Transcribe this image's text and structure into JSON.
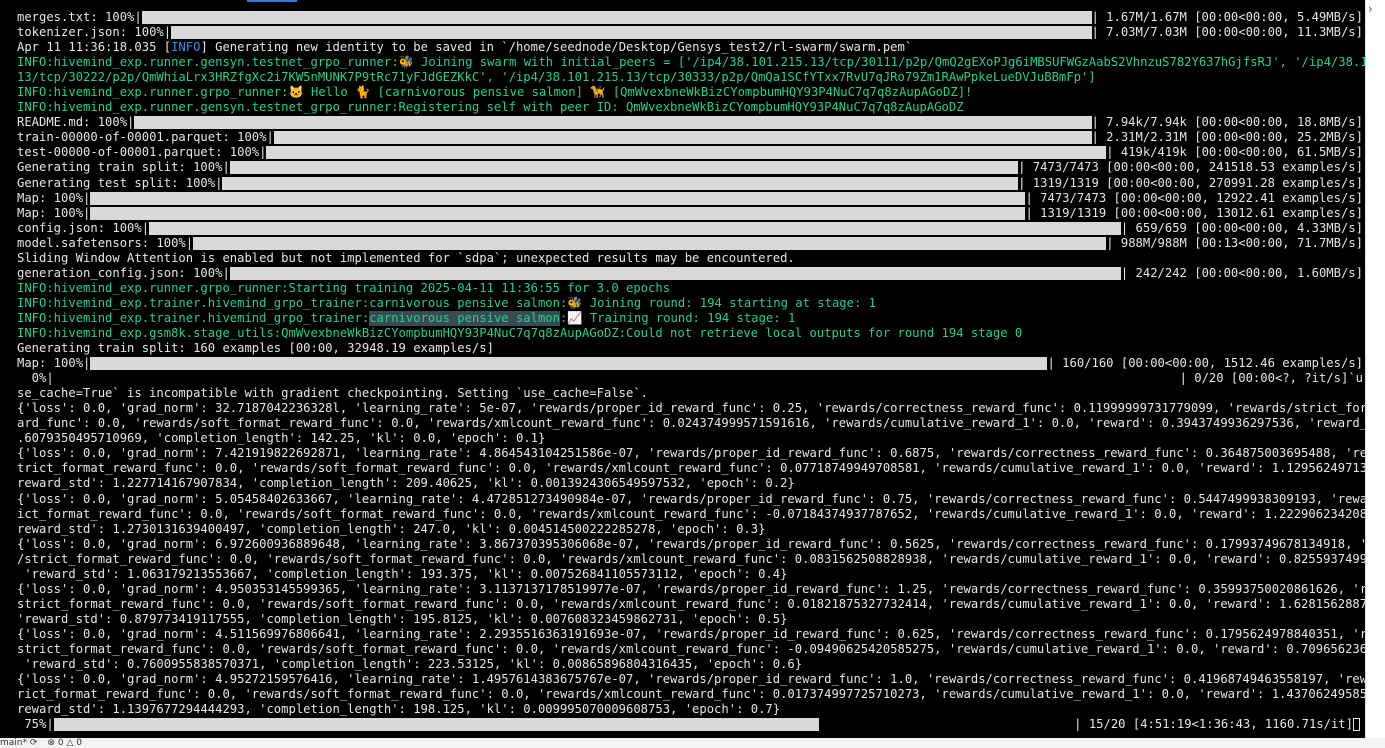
{
  "status_bar": {
    "branch": "main*",
    "sync_icon": "sync-icon",
    "problems": "0",
    "warnings": "0"
  },
  "lines": [
    {
      "type": "bar",
      "label": "merges.txt: 100%",
      "fill": 1.0,
      "stats": "| 1.67M/1.67M [00:00<00:00, 5.49MB/s]"
    },
    {
      "type": "bar",
      "label": "tokenizer.json: 100%",
      "fill": 1.0,
      "stats": "| 7.03M/7.03M [00:00<00:00, 11.3MB/s]"
    },
    {
      "type": "text",
      "segments": [
        {
          "t": "Apr 11 11:36:18.035 ["
        },
        {
          "t": "INFO",
          "c": "blue-tag"
        },
        {
          "t": "] Generating new identity to be saved in `/home/seednode/Desktop/Gensys_test2/rl-swarm/swarm.pem`"
        }
      ]
    },
    {
      "type": "text",
      "segments": [
        {
          "t": "INFO:hivemind_exp.runner.gensyn.testnet_grpo_runner:🐝 Joining swarm with initial_peers = ['/ip4/38.101.215.13/tcp/30111/p2p/QmQ2gEXoPJg6iMBSUFWGzAabS2VhnzuS782Y637hGjfsRJ', '/ip4/38.101.215.",
          "c": "green"
        }
      ]
    },
    {
      "type": "text",
      "segments": [
        {
          "t": "13/tcp/30222/p2p/QmWhiaLrx3HRZfgXc2i7KW5nMUNK7P9tRc71yFJdGEZKkC', '/ip4/38.101.215.13/tcp/30333/p2p/QmQa1SCfYTxx7RvU7qJRo79Zm1RAwPpkeLueDVJuBBmFp']",
          "c": "green"
        }
      ]
    },
    {
      "type": "text",
      "segments": [
        {
          "t": "INFO:hivemind_exp.runner.grpo_runner:🐱 Hello 🐈 [carnivorous pensive salmon] 🦮 [QmWvexbneWkBizCYompbumHQY93P4NuC7q7q8zAupAGoDZ]!",
          "c": "green"
        }
      ]
    },
    {
      "type": "text",
      "segments": [
        {
          "t": "INFO:hivemind_exp.runner.gensyn.testnet_grpo_runner:Registering self with peer ID: QmWvexbneWkBizCYompbumHQY93P4NuC7q7q8zAupAGoDZ",
          "c": "green"
        }
      ]
    },
    {
      "type": "bar",
      "label": "README.md: 100%",
      "fill": 1.0,
      "stats": "| 7.94k/7.94k [00:00<00:00, 18.8MB/s]"
    },
    {
      "type": "bar",
      "label": "train-00000-of-00001.parquet: 100%",
      "fill": 1.0,
      "stats": "| 2.31M/2.31M [00:00<00:00, 25.2MB/s]"
    },
    {
      "type": "bar",
      "label": "test-00000-of-00001.parquet: 100%",
      "fill": 1.0,
      "stats": "| 419k/419k [00:00<00:00, 61.5MB/s]"
    },
    {
      "type": "bar",
      "label": "Generating train split: 100%",
      "fill": 1.0,
      "stats": "| 7473/7473 [00:00<00:00, 241518.53 examples/s]"
    },
    {
      "type": "bar",
      "label": "Generating test split: 100%",
      "fill": 1.0,
      "stats": "| 1319/1319 [00:00<00:00, 270991.28 examples/s]"
    },
    {
      "type": "bar",
      "label": "Map: 100%",
      "fill": 1.0,
      "stats": "| 7473/7473 [00:00<00:00, 12922.41 examples/s]"
    },
    {
      "type": "bar",
      "label": "Map: 100%",
      "fill": 1.0,
      "stats": "| 1319/1319 [00:00<00:00, 13012.61 examples/s]"
    },
    {
      "type": "bar",
      "label": "config.json: 100%",
      "fill": 1.0,
      "stats": "| 659/659 [00:00<00:00, 4.33MB/s]"
    },
    {
      "type": "bar",
      "label": "model.safetensors: 100%",
      "fill": 1.0,
      "stats": "| 988M/988M [00:13<00:00, 71.7MB/s]"
    },
    {
      "type": "text",
      "segments": [
        {
          "t": "Sliding Window Attention is enabled but not implemented for `sdpa`; unexpected results may be encountered."
        }
      ]
    },
    {
      "type": "bar",
      "label": "generation_config.json: 100%",
      "fill": 1.0,
      "stats": "| 242/242 [00:00<00:00, 1.60MB/s]"
    },
    {
      "type": "text",
      "segments": [
        {
          "t": "INFO:hivemind_exp.runner.grpo_runner:Starting training 2025-04-11 11:36:55 for 3.0 epochs",
          "c": "green"
        }
      ]
    },
    {
      "type": "text",
      "segments": [
        {
          "t": "INFO:hivemind_exp.trainer.hivemind_grpo_trainer:carnivorous pensive salmon:🐝 Joining round: 194 starting at stage: 1",
          "c": "green"
        }
      ]
    },
    {
      "type": "text",
      "segments": [
        {
          "t": "INFO:hivemind_exp.trainer.hivemind_grpo_trainer:",
          "c": "green"
        },
        {
          "t": "carnivorous pensive salmon",
          "c": "green hl"
        },
        {
          "t": ":📈 Training round: 194 stage: 1",
          "c": "green"
        }
      ]
    },
    {
      "type": "text",
      "segments": [
        {
          "t": "INFO:hivemind_exp.gsm8k.stage_utils:QmWvexbneWkBizCYompbumHQY93P4NuC7q7q8zAupAGoDZ:Could not retrieve local outputs for round 194 stage 0",
          "c": "green"
        }
      ]
    },
    {
      "type": "text",
      "segments": [
        {
          "t": "Generating train split: 160 examples [00:00, 32948.19 examples/s]"
        }
      ]
    },
    {
      "type": "bar",
      "label": "Map: 100%",
      "fill": 1.0,
      "stats": "| 160/160 [00:00<00:00, 1512.46 examples/s]"
    },
    {
      "type": "bar",
      "label": "  0%",
      "fill": 0.0,
      "stats": "| 0/20 [00:00<?, ?it/s]`u"
    },
    {
      "type": "text",
      "segments": [
        {
          "t": "se_cache=True` is incompatible with gradient checkpointing. Setting `use_cache=False`."
        }
      ]
    },
    {
      "type": "text",
      "segments": [
        {
          "t": "{'loss': 0.0, 'grad_norm': 32.7187042236328l, 'learning_rate': 5e-07, 'rewards/proper_id_reward_func': 0.25, 'rewards/correctness_reward_func': 0.11999999731779099, 'rewards/strict_format_rew"
        }
      ]
    },
    {
      "type": "text",
      "segments": [
        {
          "t": "ard_func': 0.0, 'rewards/soft_format_reward_func': 0.0, 'rewards/xmlcount_reward_func': 0.024374999571591616, 'rewards/cumulative_reward_1': 0.0, 'reward': 0.3943749936297536, 'reward_std': 0"
        }
      ]
    },
    {
      "type": "text",
      "segments": [
        {
          "t": ".6079350495710969, 'completion_length': 142.25, 'kl': 0.0, 'epoch': 0.1}"
        }
      ]
    },
    {
      "type": "text",
      "segments": [
        {
          "t": "{'loss': 0.0, 'grad_norm': 7.421919822692871, 'learning_rate': 4.864543104251586e-07, 'rewards/proper_id_reward_func': 0.6875, 'rewards/correctness_reward_func': 0.364875003695488, 'rewards/s"
        }
      ]
    },
    {
      "type": "text",
      "segments": [
        {
          "t": "trict_format_reward_func': 0.0, 'rewards/soft_format_reward_func': 0.0, 'rewards/xmlcount_reward_func': 0.07718749949708581, 'rewards/cumulative_reward_1': 0.0, 'reward': 1.129562497138977, '"
        }
      ]
    },
    {
      "type": "text",
      "segments": [
        {
          "t": "reward_std': 1.227714167907834, 'completion_length': 209.40625, 'kl': 0.0013924306549597532, 'epoch': 0.2}"
        }
      ]
    },
    {
      "type": "text",
      "segments": [
        {
          "t": "{'loss': 0.0, 'grad_norm': 5.05458402633667, 'learning_rate': 4.472851273490984e-07, 'rewards/proper_id_reward_func': 0.75, 'rewards/correctness_reward_func': 0.5447499938309193, 'rewards/str"
        }
      ]
    },
    {
      "type": "text",
      "segments": [
        {
          "t": "ict_format_reward_func': 0.0, 'rewards/soft_format_reward_func': 0.0, 'rewards/xmlcount_reward_func': -0.07184374937787652, 'rewards/cumulative_reward_1': 0.0, 'reward': 1.2229062342084944, '"
        }
      ]
    },
    {
      "type": "text",
      "segments": [
        {
          "t": "reward_std': 1.2730131639400497, 'completion_length': 247.0, 'kl': 0.004514500222285278, 'epoch': 0.3}"
        }
      ]
    },
    {
      "type": "text",
      "segments": [
        {
          "t": "{'loss': 0.0, 'grad_norm': 6.972600936889648, 'learning_rate': 3.867370395306068e-07, 'rewards/proper_id_reward_func': 0.5625, 'rewards/correctness_reward_func': 0.17993749678134918, 'rewards"
        }
      ]
    },
    {
      "type": "text",
      "segments": [
        {
          "t": "/strict_format_reward_func': 0.0, 'rewards/soft_format_reward_func': 0.0, 'rewards/xmlcount_reward_func': 0.0831562508828938, 'rewards/cumulative_reward_1': 0.0, 'reward': 0.8255937499925494,"
        }
      ]
    },
    {
      "type": "text",
      "segments": [
        {
          "t": " 'reward_std': 1.063179213553667, 'completion_length': 193.375, 'kl': 0.007526841105573112, 'epoch': 0.4}"
        }
      ]
    },
    {
      "type": "text",
      "segments": [
        {
          "t": "{'loss': 0.0, 'grad_norm': 4.950353145599365, 'learning_rate': 3.1137137178519977e-07, 'rewards/proper_id_reward_func': 1.25, 'rewards/correctness_reward_func': 0.35993750020861626, 'rewards/"
        }
      ]
    },
    {
      "type": "text",
      "segments": [
        {
          "t": "strict_format_reward_func': 0.0, 'rewards/soft_format_reward_func': 0.0, 'rewards/xmlcount_reward_func': 0.01821875327732414, 'rewards/cumulative_reward_1': 0.0, 'reward': 1.628156288759783,"
        }
      ]
    },
    {
      "type": "text",
      "segments": [
        {
          "t": "'reward_std': 0.879773419117555, 'completion_length': 195.8125, 'kl': 0.007608323459862731, 'epoch': 0.5}"
        }
      ]
    },
    {
      "type": "text",
      "segments": [
        {
          "t": "{'loss': 0.0, 'grad_norm': 4.511569976806641, 'learning_rate': 2.2935516363191693e-07, 'rewards/proper_id_reward_func': 0.625, 'rewards/correctness_reward_func': 0.1795624978840351, 'rewards/"
        }
      ]
    },
    {
      "type": "text",
      "segments": [
        {
          "t": "strict_format_reward_func': 0.0, 'rewards/soft_format_reward_func': 0.0, 'rewards/xmlcount_reward_func': -0.09490625420585275, 'rewards/cumulative_reward_1': 0.0, 'reward': 0.709656236693263,"
        }
      ]
    },
    {
      "type": "text",
      "segments": [
        {
          "t": " 'reward_std': 0.7600955838570371, 'completion_length': 223.53125, 'kl': 0.00865896804316435, 'epoch': 0.6}"
        }
      ]
    },
    {
      "type": "text",
      "segments": [
        {
          "t": "{'loss': 0.0, 'grad_norm': 4.95272159576416, 'learning_rate': 1.4957614383675767e-07, 'rewards/proper_id_reward_func': 1.0, 'rewards/correctness_reward_func': 0.41968749463558197, 'rewards/st"
        }
      ]
    },
    {
      "type": "text",
      "segments": [
        {
          "t": "rict_format_reward_func': 0.0, 'rewards/soft_format_reward_func': 0.0, 'rewards/xmlcount_reward_func': 0.017374997725710273, 'rewards/cumulative_reward_1': 0.0, 'reward': 1.437062495853752, '"
        }
      ]
    },
    {
      "type": "text",
      "segments": [
        {
          "t": "reward_std': 1.1397677294444293, 'completion_length': 198.125, 'kl': 0.009995070009608753, 'epoch': 0.7}"
        }
      ]
    },
    {
      "type": "bar",
      "label": " 75%",
      "fill": 0.75,
      "stats": "| 15/20 [4:51:19<1:36:43, 1160.71s/it]",
      "cursor": true
    }
  ]
}
